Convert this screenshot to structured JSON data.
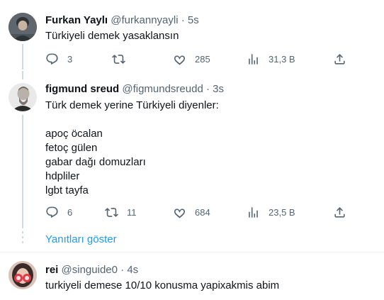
{
  "tweets": [
    {
      "name": "Furkan Yaylı",
      "handle": "@furkannyayli",
      "separator": "·",
      "time": "5s",
      "text": "Türkiyeli demek yasaklansın",
      "actions": {
        "reply_icon": "reply-icon",
        "replies": "3",
        "retweet_icon": "retweet-icon",
        "retweets": "",
        "like_icon": "like-icon",
        "likes": "285",
        "views_icon": "views-icon",
        "views": "31,3 B",
        "share_icon": "share-icon"
      }
    },
    {
      "name": "figmund sreud",
      "handle": "@figmundsreudd",
      "separator": "·",
      "time": "3s",
      "text": "Türk demek yerine Türkiyeli diyenler:\n\napoç öcalan\nfetoç gülen\ngabar dağı domuzları\nhdpliler\nlgbt tayfa",
      "actions": {
        "reply_icon": "reply-icon",
        "replies": "6",
        "retweet_icon": "retweet-icon",
        "retweets": "11",
        "like_icon": "like-icon",
        "likes": "684",
        "views_icon": "views-icon",
        "views": "23,5 B",
        "share_icon": "share-icon"
      }
    },
    {
      "name": "rei",
      "handle": "@singuide0",
      "separator": "·",
      "time": "4s",
      "text": "turkiyeli demese 10/10 konusma yapixakmis abim"
    }
  ],
  "show_replies_label": "Yanıtları göster",
  "colors": {
    "text": "#0f1419",
    "secondary": "#536471",
    "link": "#1d9bf0",
    "thread_line": "#cfd9de",
    "divider": "#eff3f4"
  }
}
